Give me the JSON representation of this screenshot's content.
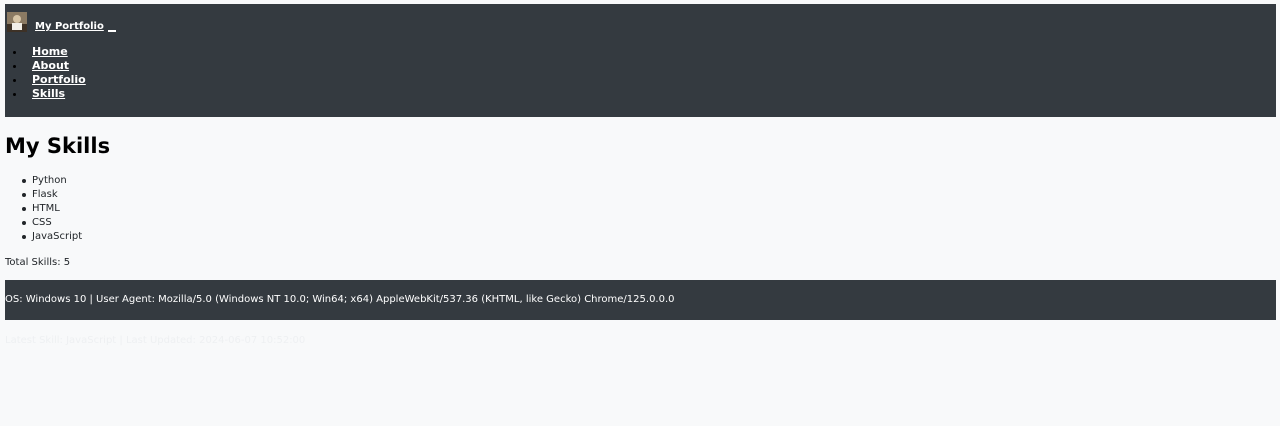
{
  "header": {
    "brand_text": "My Portfolio",
    "brand_logo_icon": "profile-photo-icon",
    "nav_items": [
      "Home",
      "About",
      "Portfolio",
      "Skills"
    ]
  },
  "main": {
    "title": "My Skills",
    "skills": [
      "Python",
      "Flask",
      "HTML",
      "CSS",
      "JavaScript"
    ],
    "total_label": "Total Skills: 5"
  },
  "info_bar": {
    "text": "OS: Windows 10 | User Agent: Mozilla/5.0 (Windows NT 10.0; Win64; x64) AppleWebKit/537.36 (KHTML, like Gecko) Chrome/125.0.0.0"
  },
  "footer": {
    "text": "Latest Skill: JavaScript | Last Updated: 2024-06-07 10:52:00"
  },
  "colors": {
    "navbar_bg": "#343a40",
    "page_bg": "#f8f9fa",
    "text_light": "#ffffff",
    "text_dark": "#212529"
  }
}
